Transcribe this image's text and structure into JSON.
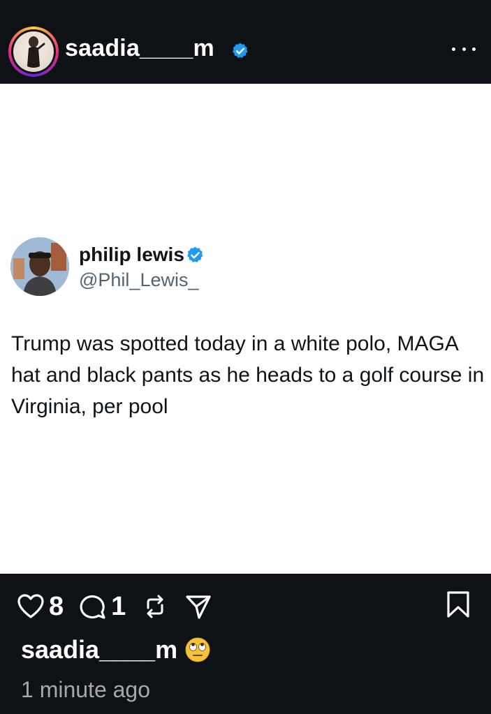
{
  "post": {
    "username": "saadia____m",
    "verified_icon": "verified-badge-icon",
    "more_icon": "more-options-icon"
  },
  "tweet": {
    "display_name": "philip lewis",
    "handle": "@Phil_Lewis_",
    "text": "Trump was spotted today in a white polo, MAGA hat and black pants as he heads to a golf course in Virginia, per pool"
  },
  "actions": {
    "like_count": "8",
    "comment_count": "1",
    "icons": [
      "heart-icon",
      "comment-icon",
      "repost-icon",
      "share-icon",
      "bookmark-icon"
    ]
  },
  "caption": {
    "username": "saadia____m",
    "emoji": "face-with-rolling-eyes"
  },
  "timestamp": "1 minute ago",
  "colors": {
    "background": "#0e1116",
    "card": "#ffffff",
    "verified": "#1d9bf0",
    "handle_gray": "#536471",
    "timestamp_gray": "#a8a8a8"
  }
}
